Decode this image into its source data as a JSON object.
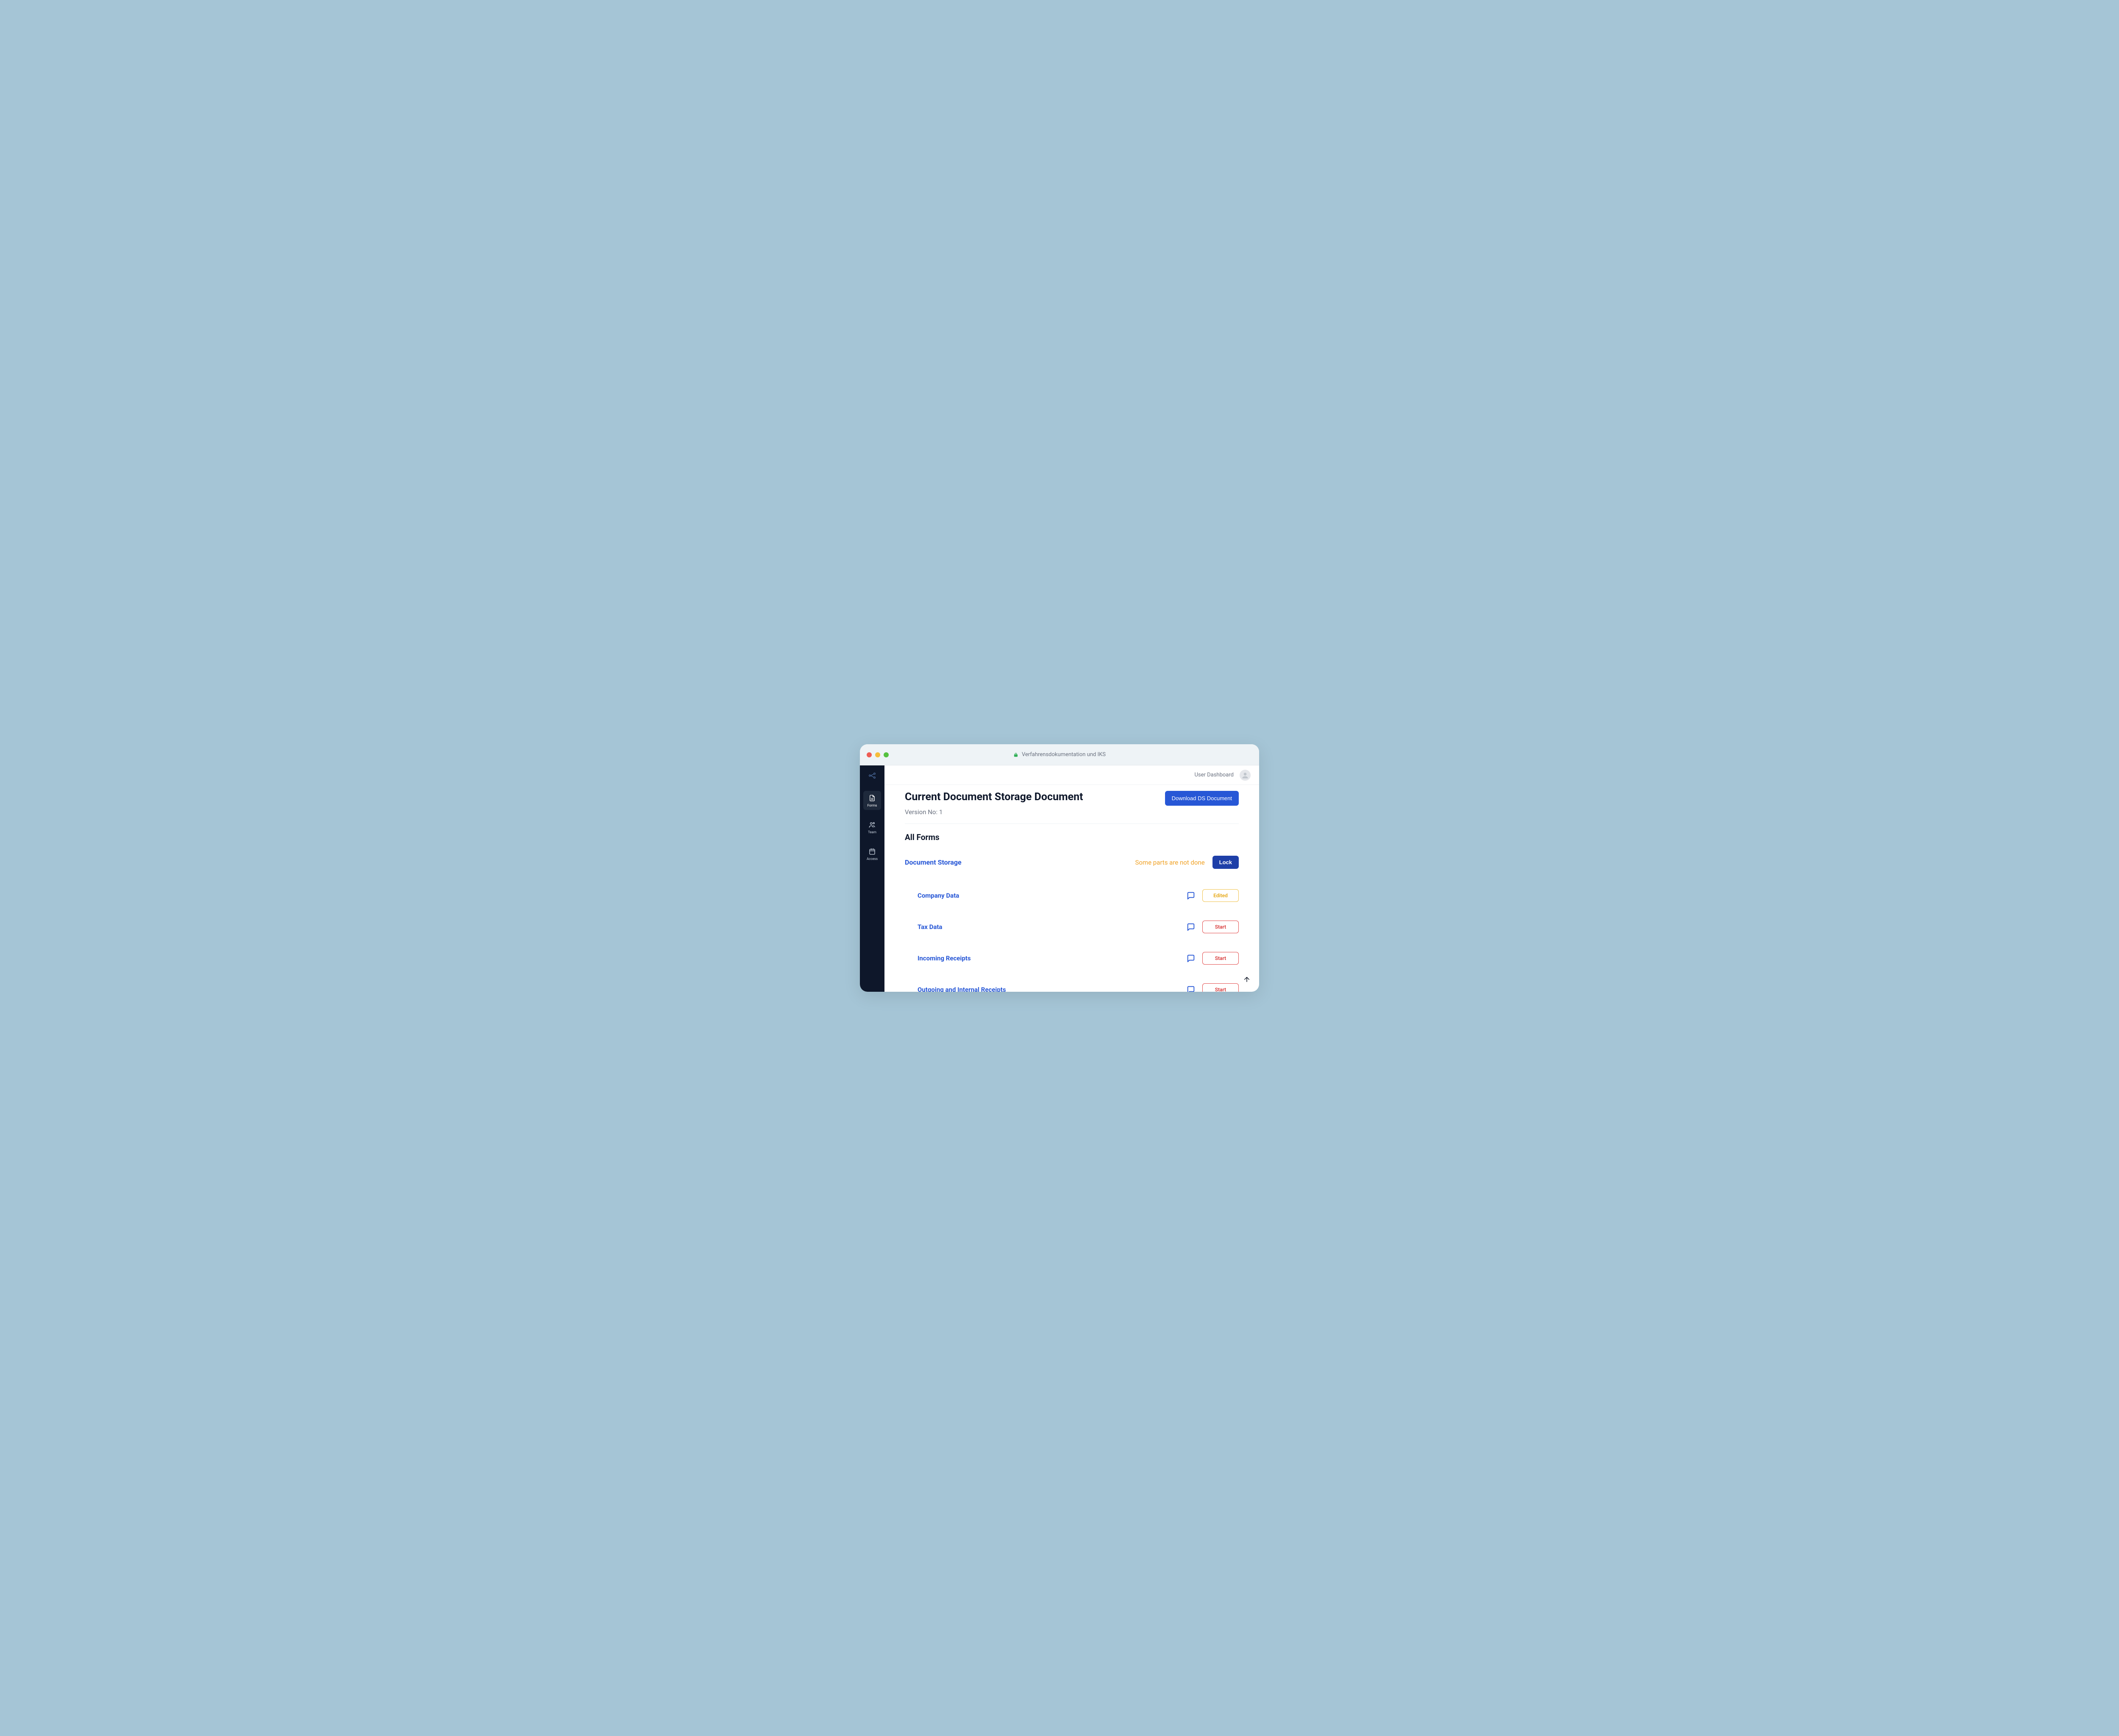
{
  "window": {
    "title": "Verfahrensdokumentation und IKS"
  },
  "sidebar": {
    "items": [
      {
        "label": "Forms",
        "icon": "document-icon",
        "active": true
      },
      {
        "label": "Team",
        "icon": "team-icon",
        "active": false
      },
      {
        "label": "Access",
        "icon": "calendar-icon",
        "active": false
      }
    ]
  },
  "topbar": {
    "dashboard_label": "User Dashboard"
  },
  "page": {
    "title": "Current Document Storage Document",
    "download_label": "Download DS Document",
    "version_label": "Version No: 1",
    "all_forms_label": "All Forms"
  },
  "group": {
    "title": "Document Storage",
    "warning": "Some parts are not done",
    "lock_label": "Lock"
  },
  "forms": [
    {
      "title": "Company Data",
      "status_label": "Edited",
      "status_kind": "edited"
    },
    {
      "title": "Tax Data",
      "status_label": "Start",
      "status_kind": "start"
    },
    {
      "title": "Incoming Receipts",
      "status_label": "Start",
      "status_kind": "start"
    },
    {
      "title": "Outgoing and Internal Receipts",
      "status_label": "Start",
      "status_kind": "start"
    }
  ],
  "colors": {
    "primary": "#2757d6",
    "warn": "#f0a226",
    "danger": "#d83a3a",
    "sidebar": "#0e172a"
  }
}
